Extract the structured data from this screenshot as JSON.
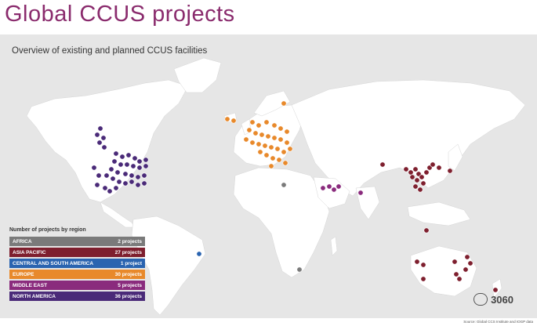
{
  "title": "Global CCUS projects",
  "subtitle": "Overview of existing and planned CCUS facilities",
  "legend": {
    "title": "Number of projects by region",
    "rows": [
      {
        "region": "AFRICA",
        "count": "2 projects",
        "color": "#7a7a7a"
      },
      {
        "region": "ASIA PACIFIC",
        "count": "27 projects",
        "color": "#7e1f2e"
      },
      {
        "region": "CENTRAL AND SOUTH AMERICA",
        "count": "1 project",
        "color": "#2a64b0"
      },
      {
        "region": "EUROPE",
        "count": "30 projects",
        "color": "#e8892b"
      },
      {
        "region": "MIDDLE EAST",
        "count": "5 projects",
        "color": "#8a2b7d"
      },
      {
        "region": "NORTH AMERICA",
        "count": "36 projects",
        "color": "#4a2a78"
      }
    ]
  },
  "source": "Source: Global CCS Institute and IOGP data",
  "watermark": "3060",
  "marker_colors": {
    "north_america": "#4a2a78",
    "europe": "#e8892b",
    "asia_pacific": "#7e1f2e",
    "middle_east": "#8a2b7d",
    "africa": "#7a7a7a",
    "south_america": "#2a64b0"
  }
}
